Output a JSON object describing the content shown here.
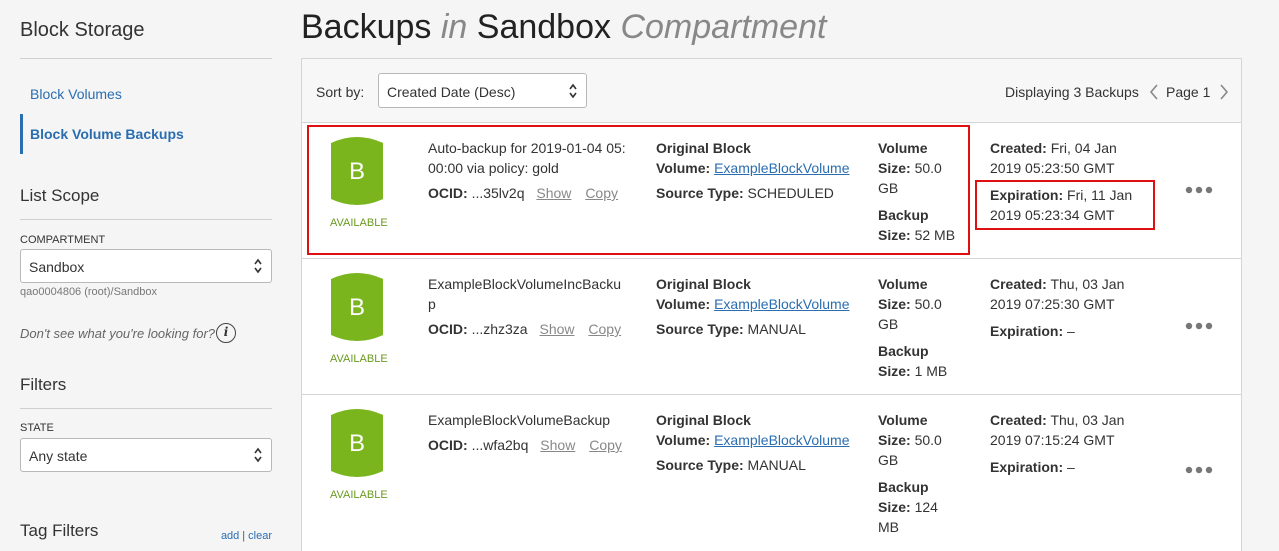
{
  "sidebar": {
    "title": "Block Storage",
    "nav": [
      {
        "label": "Block Volumes"
      },
      {
        "label": "Block Volume Backups"
      }
    ],
    "list_scope": {
      "title": "List Scope",
      "compartment_label": "COMPARTMENT",
      "compartment_value": "Sandbox",
      "compartment_path": "qao0004806 (root)/Sandbox",
      "help_text": "Don't see what you're looking for?",
      "info_glyph": "i"
    },
    "filters": {
      "title": "Filters",
      "state_label": "STATE",
      "state_value": "Any state"
    },
    "tag_filters": {
      "title": "Tag Filters",
      "add": "add",
      "separator": "|",
      "clear": "clear"
    }
  },
  "header": {
    "title_a": "Backups",
    "title_in": "in",
    "title_b": "Sandbox",
    "title_c": "Compartment"
  },
  "toolbar": {
    "sort_label": "Sort by:",
    "sort_value": "Created Date (Desc)",
    "display_count": "Displaying 3 Backups",
    "page_label": "Page 1"
  },
  "backups": [
    {
      "icon_letter": "B",
      "status": "AVAILABLE",
      "name": "Auto-backup for 2019-01-04 05:00:00 via policy: gold",
      "ocid_label": "OCID:",
      "ocid_value": "...35lv2q",
      "show": "Show",
      "copy": "Copy",
      "orig_label_1": "Original Block",
      "orig_label_2": "Volume:",
      "orig_link": "ExampleBlockVolume",
      "src_label": "Source Type:",
      "src_value": "SCHEDULED",
      "vol_label_1": "Volume",
      "vol_label_2": "Size:",
      "vol_value_1": "50.0",
      "vol_value_2": "GB",
      "bkp_label_1": "Backup",
      "bkp_label_2": "Size:",
      "bkp_value": "52 MB",
      "bkp_value_2": "",
      "created_label": "Created:",
      "created_value": "Fri, 04 Jan 2019 05:23:50 GMT",
      "exp_label": "Expiration:",
      "exp_value": "Fri, 11 Jan 2019 05:23:34 GMT"
    },
    {
      "icon_letter": "B",
      "status": "AVAILABLE",
      "name": "ExampleBlockVolumeIncBackup",
      "ocid_label": "OCID:",
      "ocid_value": "...zhz3za",
      "show": "Show",
      "copy": "Copy",
      "orig_label_1": "Original Block",
      "orig_label_2": "Volume:",
      "orig_link": "ExampleBlockVolume",
      "src_label": "Source Type:",
      "src_value": "MANUAL",
      "vol_label_1": "Volume",
      "vol_label_2": "Size:",
      "vol_value_1": "50.0",
      "vol_value_2": "GB",
      "bkp_label_1": "Backup",
      "bkp_label_2": "Size:",
      "bkp_value": "1 MB",
      "bkp_value_2": "",
      "created_label": "Created:",
      "created_value": "Thu, 03 Jan 2019 07:25:30 GMT",
      "exp_label": "Expiration:",
      "exp_value": "–"
    },
    {
      "icon_letter": "B",
      "status": "AVAILABLE",
      "name": "ExampleBlockVolumeBackup",
      "ocid_label": "OCID:",
      "ocid_value": "...wfa2bq",
      "show": "Show",
      "copy": "Copy",
      "orig_label_1": "Original Block",
      "orig_label_2": "Volume:",
      "orig_link": "ExampleBlockVolume",
      "src_label": "Source Type:",
      "src_value": "MANUAL",
      "vol_label_1": "Volume",
      "vol_label_2": "Size:",
      "vol_value_1": "50.0",
      "vol_value_2": "GB",
      "bkp_label_1": "Backup",
      "bkp_label_2": "Size:",
      "bkp_value": "124",
      "bkp_value_2": "MB",
      "created_label": "Created:",
      "created_value": "Thu, 03 Jan 2019 07:15:24 GMT",
      "exp_label": "Expiration:",
      "exp_value": "–"
    }
  ],
  "colors": {
    "accent": "#2a6db0",
    "available_green": "#7ab51d",
    "status_text": "#6a9a1e",
    "highlight_red": "#e01010"
  },
  "icons": [
    "chevron-updown-icon",
    "info-icon",
    "chevron-left-icon",
    "chevron-right-icon",
    "database-icon",
    "more-actions-icon"
  ]
}
